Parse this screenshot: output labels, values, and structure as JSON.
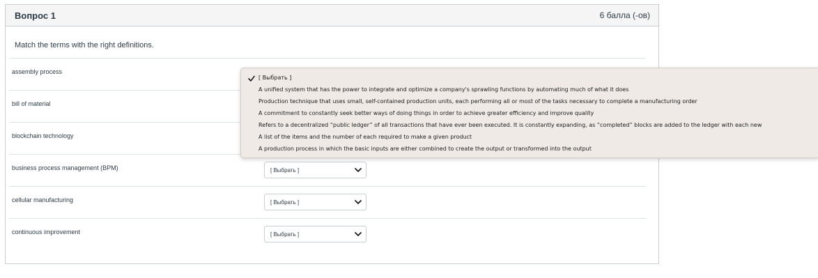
{
  "question": {
    "title": "Вопрос 1",
    "points": "6 балла (-ов)",
    "text": "Match the terms with the right definitions."
  },
  "rows": [
    {
      "term": "assembly process",
      "selected": "[ Выбрать ]"
    },
    {
      "term": "bill of material",
      "selected": "[ Выбрать ]"
    },
    {
      "term": "blockchain technology",
      "selected": "[ Выбрать ]"
    },
    {
      "term": "business process management (BPM)",
      "selected": "[ Выбрать ]"
    },
    {
      "term": "cellular manufacturing",
      "selected": "[ Выбрать ]"
    },
    {
      "term": "continuous improvement",
      "selected": "[ Выбрать ]"
    }
  ],
  "dropdown": {
    "options": [
      "[ Выбрать ]",
      "A unified system that has the power to integrate and optimize a company's sprawling functions by automating much of what it does",
      "Production technique that uses small, self-contained production units, each performing all or most of the tasks necessary to complete a manufacturing order",
      "A commitment to constantly seek better ways of doing things in order to achieve greater efficiency and improve quality",
      "Refers to a decentralized “public ledger” of all transactions that have ever been executed. It is constantly expanding, as “completed” blocks are added to the ledger with each new",
      "A list of the items and the number of each required to make a given product",
      "A production process in which the basic inputs are either combined to create the output or transformed into the output"
    ],
    "checked_index": 0
  }
}
